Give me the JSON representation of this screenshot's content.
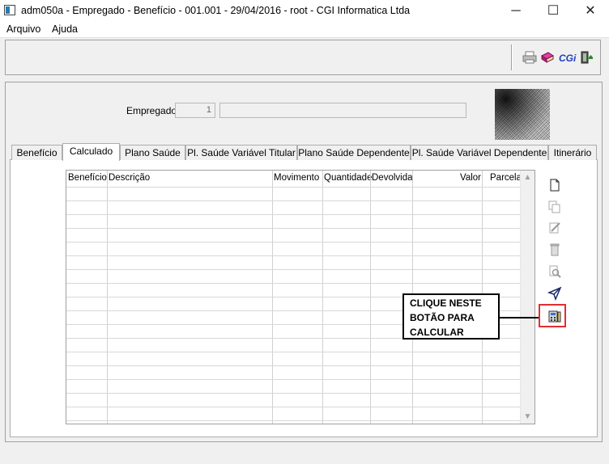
{
  "window": {
    "title": "adm050a - Empregado - Benefício - 001.001 - 29/04/2016 - root - CGI Informatica Ltda",
    "minimize": "─",
    "maximize": "☐",
    "close": "✕"
  },
  "menu": [
    {
      "label": "Arquivo"
    },
    {
      "label": "Ajuda"
    }
  ],
  "toolbar": {
    "icons": [
      "printer-icon",
      "book-icon",
      "cgi-logo-icon",
      "exit-door-icon"
    ],
    "cgi_text": "CGi"
  },
  "form": {
    "empregado_label": "Empregado:",
    "empregado_code": "1",
    "empregado_name": ""
  },
  "tabs": [
    {
      "label": "Benefício",
      "active": false
    },
    {
      "label": "Calculado",
      "active": true
    },
    {
      "label": "Plano Saúde",
      "active": false
    },
    {
      "label": "Pl. Saúde Variável Titular",
      "active": false
    },
    {
      "label": "Plano Saúde Dependente",
      "active": false
    },
    {
      "label": "Pl. Saúde Variável Dependente",
      "active": false
    },
    {
      "label": "Itinerário",
      "active": false
    }
  ],
  "grid": {
    "columns": [
      "Benefício",
      "Descrição",
      "Movimento",
      "Quantidade",
      "Devolvida",
      "Valor",
      "Parcela"
    ],
    "rows": []
  },
  "side_buttons": [
    "new-record-icon",
    "copy-record-icon",
    "edit-record-icon",
    "delete-record-icon",
    "search-record-icon",
    "send-icon",
    "calculate-icon"
  ],
  "callout": {
    "lines": [
      "CLIQUE NESTE",
      "BOTÃO PARA",
      "CALCULAR"
    ]
  },
  "colors": {
    "highlight": "#e03030",
    "cgi_blue": "#1f3fbf"
  }
}
